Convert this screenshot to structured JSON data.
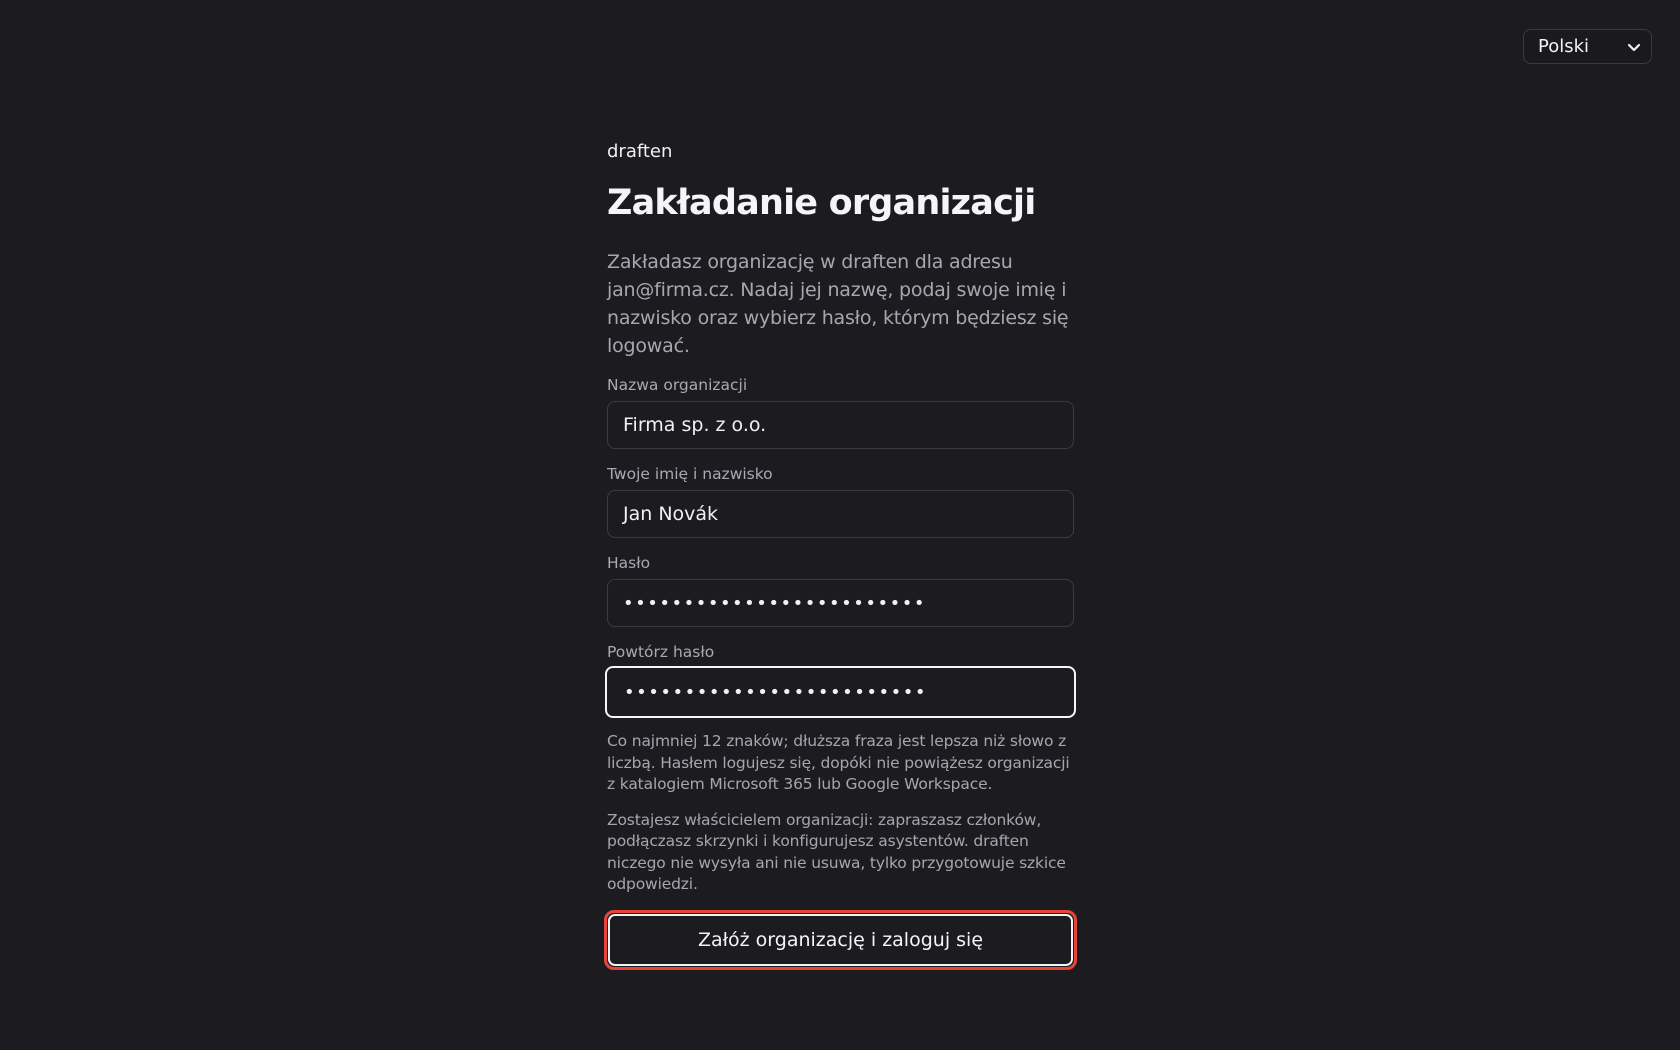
{
  "language": {
    "selected": "Polski"
  },
  "brand": "draften",
  "title": "Zakładanie organizacji",
  "intro": "Zakładasz organizację w draften dla adresu jan@firma.cz. Nadaj jej nazwę, podaj swoje imię i nazwisko oraz wybierz hasło, którym będziesz się logować.",
  "fields": {
    "org_name": {
      "label": "Nazwa organizacji",
      "value": "Firma sp. z o.o."
    },
    "full_name": {
      "label": "Twoje imię i nazwisko",
      "value": "Jan Novák"
    },
    "password": {
      "label": "Hasło",
      "value": "•••••••••••••••••••••••••"
    },
    "password_repeat": {
      "label": "Powtórz hasło",
      "value": "•••••••••••••••••••••••••"
    }
  },
  "hints": {
    "password": "Co najmniej 12 znaków; dłuższa fraza jest lepsza niż słowo z liczbą. Hasłem logujesz się, dopóki nie powiążesz organizacji z katalogiem Microsoft 365 lub Google Workspace.",
    "owner": "Zostajesz właścicielem organizacji: zapraszasz członków, podłączasz skrzynki i konfigurujesz asystentów. draften niczego nie wysyła ani nie usuwa, tylko przygotowuje szkice odpowiedzi."
  },
  "submit_label": "Załóż organizację i zaloguj się",
  "icons": {
    "language_chevron": "chevron-down-icon"
  },
  "colors": {
    "background": "#1c1c20",
    "focus_ring": "#e8453a"
  }
}
